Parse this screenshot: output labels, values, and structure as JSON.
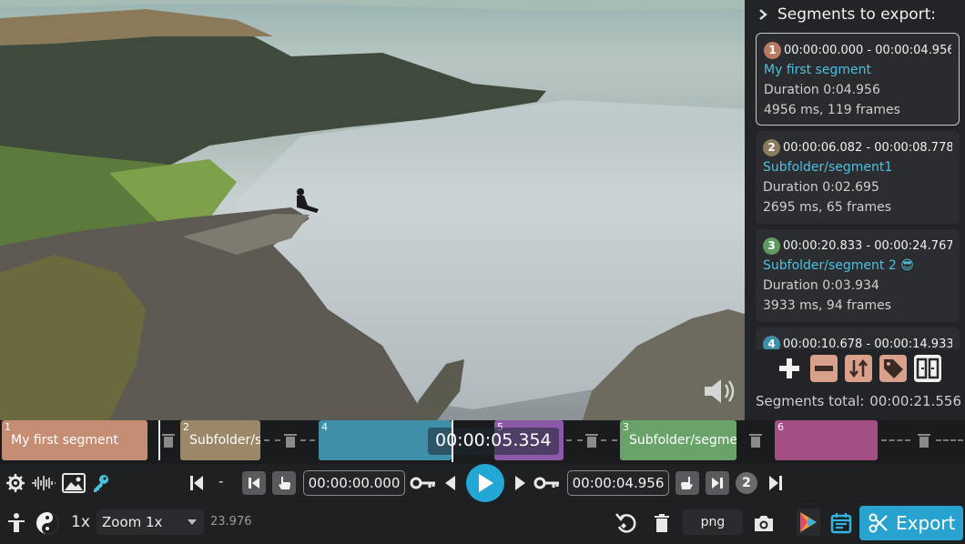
{
  "colors": {
    "accent": "#28a3cf",
    "segment_name": "#4fc1e0",
    "seg1": "#c58d73",
    "seg2": "#9a8869",
    "seg3": "#6aa36a",
    "seg4": "#3e8fa8",
    "seg5": "#8a5aa8",
    "seg6": "#a34f84"
  },
  "sidebar": {
    "title": "Segments to export:",
    "segments": [
      {
        "num": "1",
        "range": "00:00:00.000 - 00:00:04.956",
        "name": "My first segment",
        "duration": "Duration 0:04.956",
        "stats": "4956 ms, 119 frames",
        "color": "#b87a62"
      },
      {
        "num": "2",
        "range": "00:00:06.082 - 00:00:08.778",
        "name": "Subfolder/segment1",
        "duration": "Duration 0:02.695",
        "stats": "2695 ms, 65 frames",
        "color": "#8c7a5c"
      },
      {
        "num": "3",
        "range": "00:00:20.833 - 00:00:24.767",
        "name": "Subfolder/segment 2 😎",
        "duration": "Duration 0:03.934",
        "stats": "3933 ms, 94 frames",
        "color": "#5f9a5f"
      },
      {
        "num": "4",
        "range": "00:00:10.678 - 00:00:14.933",
        "name": "",
        "duration": "",
        "stats": "",
        "color": "#3e8fa8"
      }
    ],
    "total_label": "Segments total:",
    "total_value": "00:00:21.556"
  },
  "timeline": {
    "current_time": "00:00:05.354",
    "segments": [
      {
        "idx": "1",
        "label": "My first segment"
      },
      {
        "idx": "2",
        "label": "Subfolder/se"
      },
      {
        "idx": "4",
        "label": ""
      },
      {
        "idx": "5",
        "label": ""
      },
      {
        "idx": "3",
        "label": "Subfolder/segmer"
      },
      {
        "idx": "6",
        "label": ""
      }
    ]
  },
  "controls": {
    "cut_start": "00:00:00.000",
    "cut_end": "00:00:04.956",
    "dash": "-",
    "segment_badge": "2",
    "speed": "1x",
    "zoom": "Zoom 1x",
    "fps": "23.976",
    "format": "png",
    "export_label": "Export"
  },
  "icons": [
    "chevron-right-icon",
    "plus-icon",
    "minus-icon",
    "sort-icon",
    "tag-icon",
    "split-icon",
    "volume-icon",
    "trash-icon",
    "settings-icon",
    "waveform-icon",
    "image-icon",
    "key-icon",
    "skip-start-icon",
    "jump-start-icon",
    "hand-icon",
    "play-icon",
    "rewind-icon",
    "forward-icon",
    "jump-end-icon",
    "skip-end-icon",
    "yinyang-icon",
    "person-icon",
    "rotate-icon",
    "camera-icon",
    "calendar-icon",
    "scissors-icon"
  ]
}
